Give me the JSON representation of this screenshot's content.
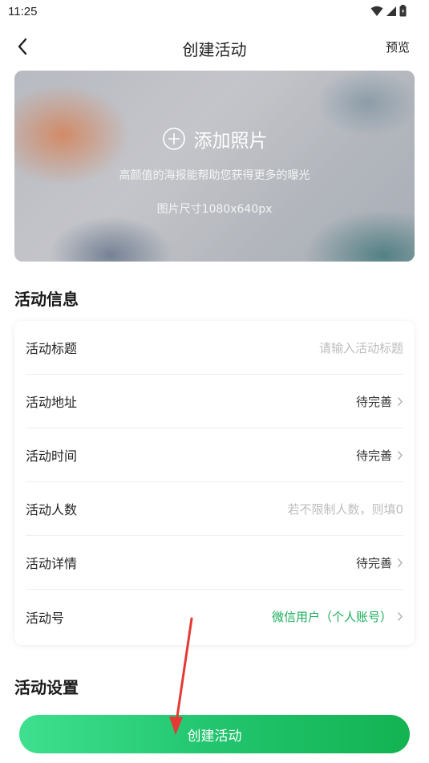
{
  "status_bar": {
    "time": "11:25"
  },
  "header": {
    "title": "创建活动",
    "preview_label": "预览"
  },
  "banner": {
    "add_label": "添加照片",
    "subtitle": "高颜值的海报能帮助您获得更多的曝光",
    "size_hint": "图片尺寸1080x640px"
  },
  "sections": {
    "info_title": "活动信息",
    "settings_title": "活动设置"
  },
  "form": {
    "rows": [
      {
        "label": "活动标题",
        "value": "请输入活动标题"
      },
      {
        "label": "活动地址",
        "value": "待完善"
      },
      {
        "label": "活动时间",
        "value": "待完善"
      },
      {
        "label": "活动人数",
        "value": "若不限制人数，则填0"
      },
      {
        "label": "活动详情",
        "value": "待完善"
      },
      {
        "label": "活动号",
        "value": "微信用户（个人账号）"
      }
    ]
  },
  "footer": {
    "create_label": "创建活动"
  },
  "colors": {
    "accent_green": "#1aad59",
    "button_gradient_start": "#3ee08f",
    "button_gradient_end": "#13b352",
    "annotation_arrow": "#e53935"
  }
}
